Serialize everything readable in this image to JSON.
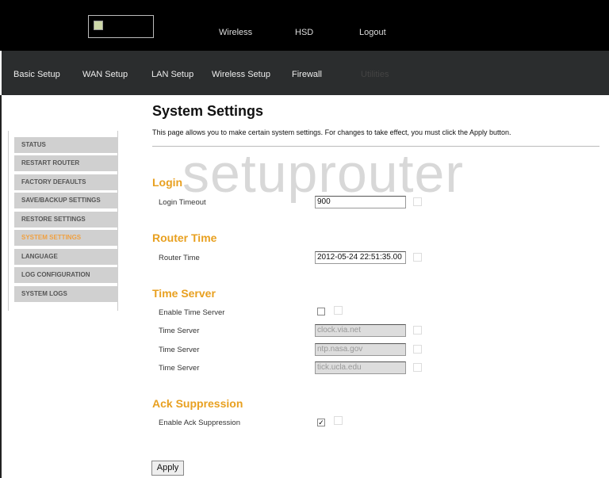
{
  "header": {
    "links": [
      "Wireless",
      "HSD",
      "Logout"
    ]
  },
  "nav": {
    "items": [
      "Basic Setup",
      "WAN Setup",
      "LAN Setup",
      "Wireless Setup",
      "Firewall",
      "Utilities"
    ]
  },
  "sidebar": {
    "items": [
      "STATUS",
      "RESTART ROUTER",
      "FACTORY DEFAULTS",
      "SAVE/BACKUP SETTINGS",
      "RESTORE SETTINGS",
      "SYSTEM SETTINGS",
      "LANGUAGE",
      "LOG CONFIGURATION",
      "SYSTEM LOGS"
    ],
    "active": "SYSTEM SETTINGS"
  },
  "page": {
    "title": "System Settings",
    "description": "This page allows you to make certain system settings. For changes to take effect, you must click the Apply button."
  },
  "watermark": "setuprouter",
  "login": {
    "heading": "Login",
    "timeout_label": "Login Timeout",
    "timeout_value": "900"
  },
  "router_time": {
    "heading": "Router Time",
    "label": "Router Time",
    "value": "2012-05-24 22:51:35.00"
  },
  "time_server": {
    "heading": "Time Server",
    "enable_label": "Enable Time Server",
    "enabled": false,
    "server_label": "Time Server",
    "servers": [
      "clock.via.net",
      "ntp.nasa.gov",
      "tick.ucla.edu"
    ]
  },
  "ack": {
    "heading": "Ack Suppression",
    "enable_label": "Enable Ack Suppression",
    "enabled": true,
    "check": "✓"
  },
  "apply_label": "Apply",
  "colors": {
    "accent": "#e8a020",
    "nav_bg": "#2b2d2e"
  }
}
